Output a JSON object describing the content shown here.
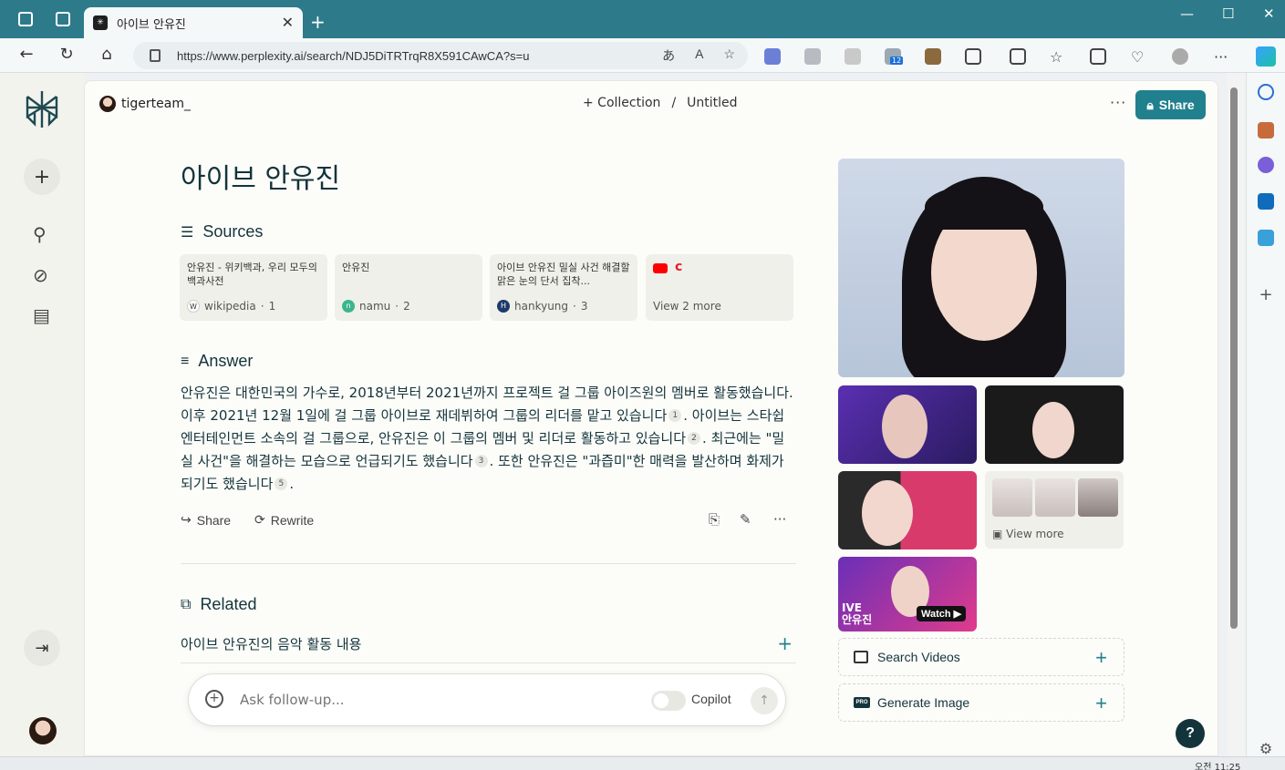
{
  "browser": {
    "tab_title": "아이브 안유진",
    "url": "https://www.perplexity.ai/search/NDJ5DiTRTrqR8X591CAwCA?s=u",
    "extension_badge": "12"
  },
  "header": {
    "user": "tigerteam_",
    "collection": "+ Collection",
    "separator": "/",
    "page_title": "Untitled",
    "more": "···",
    "share": "Share"
  },
  "query": "아이브 안유진",
  "sources": {
    "title": "Sources",
    "cards": [
      {
        "title": "안유진 - 위키백과, 우리 모두의 백과사전",
        "site": "wikipedia",
        "index": "1"
      },
      {
        "title": "안유진",
        "site": "namu",
        "index": "2"
      },
      {
        "title": "아이브 안유진 밀실 사건 해결할 맑은 눈의 단서 집착...",
        "site": "hankyung",
        "index": "3"
      },
      {
        "title": "",
        "site": "View 2 more",
        "index": ""
      }
    ]
  },
  "answer": {
    "title": "Answer",
    "seg1": "안유진은 대한민국의 가수로, 2018년부터 2021년까지 프로젝트 걸 그룹 아이즈원의 멤버로 활동했습니다. 이후 2021년 12월 1일에 걸 그룹 아이브로 재데뷔하여 그룹의 리더를 맡고 있습니다",
    "c1": "1",
    "seg2": ". 아이브는 스타쉽 엔터테인먼트 소속의 걸 그룹으로, 안유진은 이 그룹의 멤버 및 리더로 활동하고 있습니다",
    "c2": "2",
    "seg3": ". 최근에는 \"밀실 사건\"을 해결하는 모습으로 언급되기도 했습니다",
    "c3": "3",
    "seg4": ". 또한 안유진은 \"과즙미\"한 매력을 발산하며 화제가 되기도 했습니다",
    "c4": "5",
    "seg5": ".",
    "share": "Share",
    "rewrite": "Rewrite"
  },
  "related": {
    "title": "Related",
    "items": [
      "아이브 안유진의 음악 활동 내용"
    ]
  },
  "followup": {
    "placeholder": "Ask follow-up...",
    "copilot": "Copilot"
  },
  "media": {
    "view_more": "View more",
    "watch": "Watch",
    "video_tag": "IVE\n안유진",
    "search_videos": "Search Videos",
    "generate_image": "Generate Image",
    "pro_badge": "PRO"
  },
  "help": "?",
  "taskbar": {
    "clock": "오전 11:25"
  },
  "colors": {
    "accent": "#21808d",
    "chrome": "#2d7b8a"
  }
}
